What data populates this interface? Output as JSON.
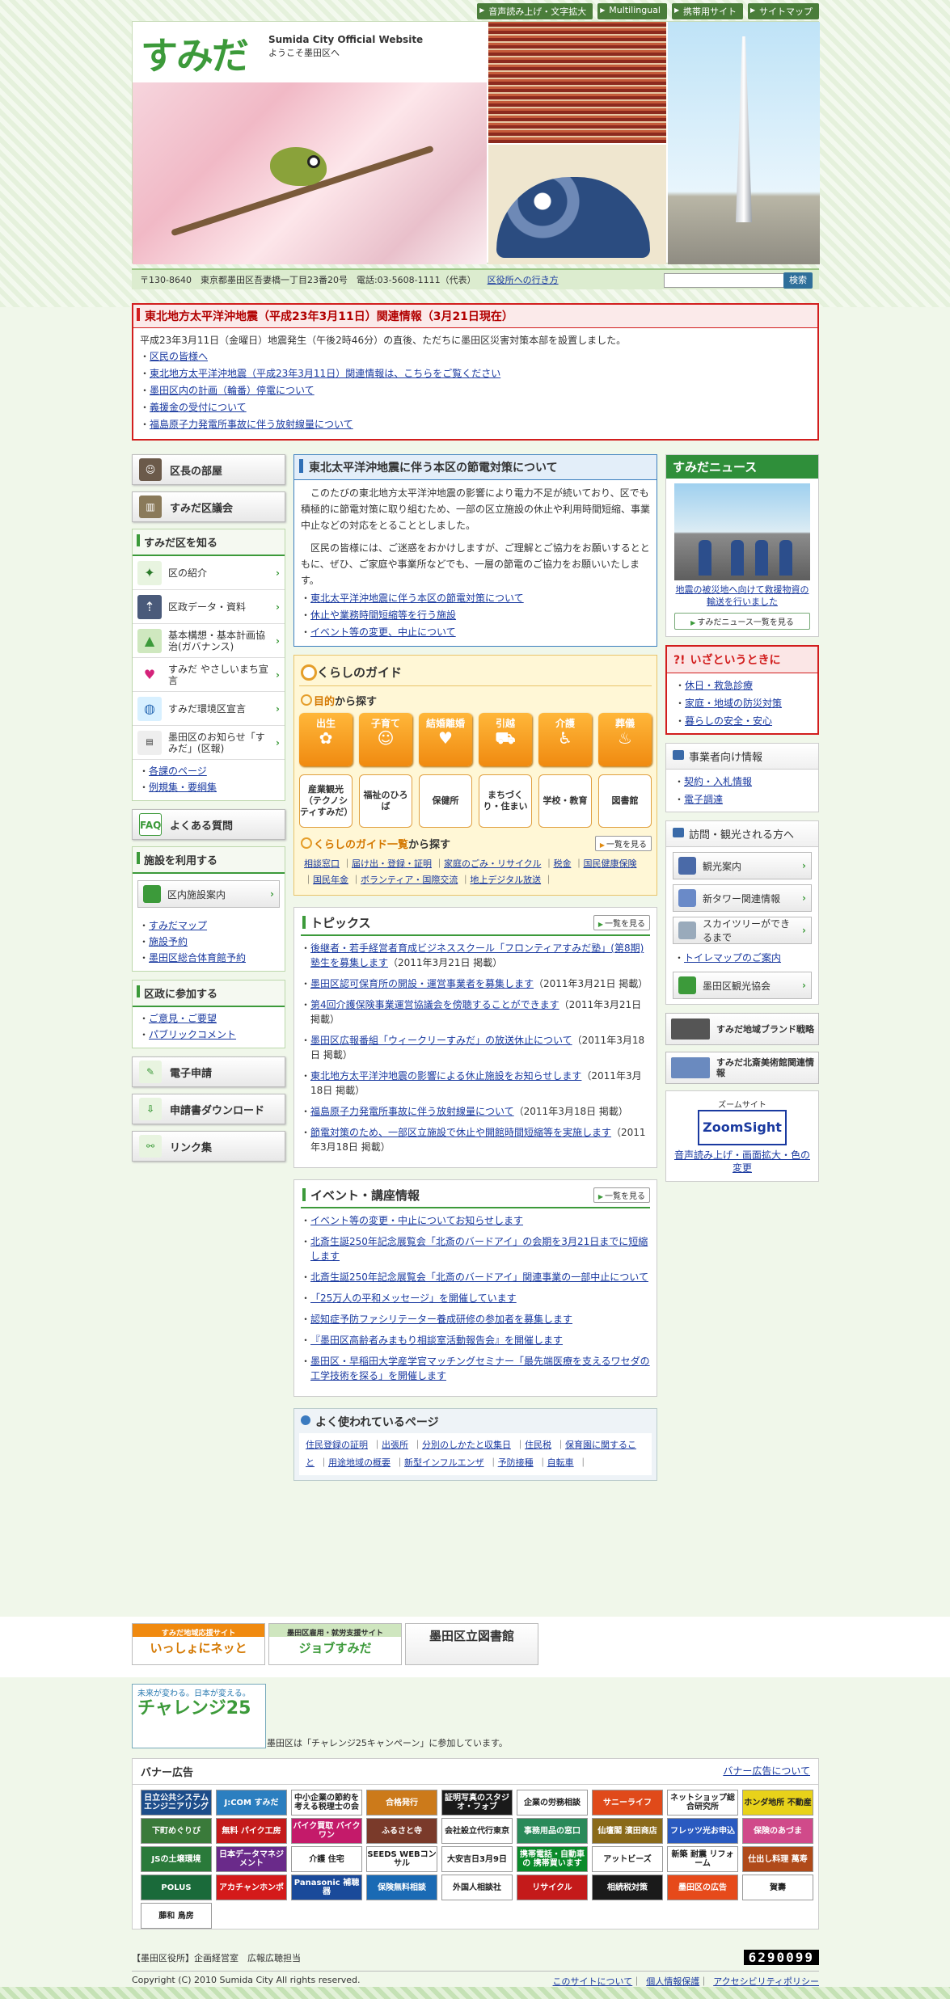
{
  "util": [
    "音声読み上げ・文字拡大",
    "Multilingual",
    "携帯用サイト",
    "サイトマップ"
  ],
  "logo": {
    "text": "すみだ",
    "sub1": "Sumida City  Official Website",
    "sub2": "ようこそ墨田区へ"
  },
  "addr": {
    "text": "〒130-8640　東京都墨田区吾妻橋一丁目23番20号　電話:03-5608-1111（代表）",
    "link": "区役所への行き方",
    "search_btn": "検索"
  },
  "emergency": {
    "title": "東北地方太平洋沖地震（平成23年3月11日）関連情報（3月21日現在）",
    "body": "平成23年3月11日（金曜日）地震発生（午後2時46分）の直後、ただちに墨田区災害対策本部を設置しました。",
    "links": [
      "区民の皆様へ",
      "東北地方太平洋沖地震（平成23年3月11日）関連情報は、こちらをご覧ください",
      "墨田区内の計画（輪番）停電について",
      "義援金の受付について",
      "福島原子力発電所事故に伴う放射線量について"
    ]
  },
  "left": {
    "btn_mayor": "区長の部屋",
    "btn_council": "すみだ区議会",
    "know_title": "すみだ区を知る",
    "know_items": [
      "区の紹介",
      "区政データ・資料",
      "基本構想・基本計画協治(ガバナンス)",
      "すみだ やさしいまち宣言",
      "すみだ環境区宣言",
      "墨田区のお知らせ「すみだ」(区報)"
    ],
    "know_links": [
      "各課のページ",
      "例規集・要綱集"
    ],
    "faq": "よくある質問",
    "facility_title": "施設を利用する",
    "facility_btn": "区内施設案内",
    "facility_links": [
      "すみだマップ",
      "施設予約",
      "墨田区総合体育館予約"
    ],
    "join_title": "区政に参加する",
    "join_links": [
      "ご意見・ご要望",
      "パブリックコメント"
    ],
    "btn_e": "電子申請",
    "btn_dl": "申請書ダウンロード",
    "btn_link": "リンク集"
  },
  "save": {
    "title": "東北太平洋沖地震に伴う本区の節電対策について",
    "p1": "このたびの東北地方太平洋沖地震の影響により電力不足が続いており、区でも積極的に節電対策に取り組むため、一部の区立施設の休止や利用時間短縮、事業中止などの対応をとることとしました。",
    "p2": "区民の皆様には、ご迷惑をおかけしますが、ご理解とご協力をお願いするとともに、ぜひ、ご家庭や事業所などでも、一層の節電のご協力をお願いいたします。",
    "links": [
      "東北太平洋沖地震に伴う本区の節電対策について",
      "休止や業務時間短縮等を行う施設",
      "イベント等の変更、中止について"
    ]
  },
  "guide": {
    "title": "くらしのガイド",
    "purpose_em": "目的",
    "purpose": "から探す",
    "tiles1": [
      "出生",
      "子育て",
      "結婚離婚",
      "引越",
      "介護",
      "葬儀"
    ],
    "icons1": [
      "✿",
      "☺",
      "♥",
      "⛟",
      "♿",
      "♨"
    ],
    "tiles2": [
      "産業観光（テクノシティすみだ）",
      "福祉のひろば",
      "保健所",
      "まちづくり・住まい",
      "学校・教育",
      "図書館"
    ],
    "list_em": "くらしのガイド一覧",
    "list": "から探す",
    "more": "一覧を見る",
    "links": [
      "相談窓口",
      "届け出・登録・証明",
      "家庭のごみ・リサイクル",
      "税金",
      "国民健康保険",
      "国民年金",
      "ボランティア・国際交流",
      "地上デジタル放送"
    ]
  },
  "topics": {
    "title": "トピックス",
    "more": "一覧を見る",
    "items": [
      {
        "t": "後継者・若手経営者育成ビジネススクール「フロンティアすみだ塾」(第8期)塾生を募集します",
        "d": "（2011年3月21日 掲載）"
      },
      {
        "t": "墨田区認可保育所の開設・運営事業者を募集します",
        "d": "（2011年3月21日 掲載）"
      },
      {
        "t": "第4回介護保険事業運営協議会を傍聴することができます",
        "d": "（2011年3月21日 掲載）"
      },
      {
        "t": "墨田区広報番組「ウィークリーすみだ」の放送休止について",
        "d": "（2011年3月18日 掲載）"
      },
      {
        "t": "東北地方太平洋沖地震の影響による休止施設をお知らせします",
        "d": "（2011年3月18日 掲載）"
      },
      {
        "t": "福島原子力発電所事故に伴う放射線量について",
        "d": "（2011年3月18日 掲載）"
      },
      {
        "t": "節電対策のため、一部区立施設で休止や開館時間短縮等を実施します",
        "d": "（2011年3月18日 掲載）"
      }
    ]
  },
  "events": {
    "title": "イベント・講座情報",
    "more": "一覧を見る",
    "items": [
      "イベント等の変更・中止についてお知らせします",
      "北斎生誕250年記念展覧会「北斎のバードアイ」の会期を3月21日までに短縮します",
      "北斎生誕250年記念展覧会「北斎のバードアイ」関連事業の一部中止について",
      "「25万人の平和メッセージ」を開催しています",
      "認知症予防ファシリテーター養成研修の参加者を募集します",
      "『墨田区高齢者みまもり相談室活動報告会』を開催します",
      "墨田区・早稲田大学産学官マッチングセミナー「最先端医療を支えるワセダの工学技術を探る」を開催します"
    ]
  },
  "often": {
    "title": "よく使われているページ",
    "links": [
      "住民登録の証明",
      "出張所",
      "分別のしかたと収集日",
      "住民税",
      "保育園に関すること",
      "用途地域の概要",
      "新型インフルエンザ",
      "予防接種",
      "自転車"
    ]
  },
  "right": {
    "news_title": "すみだニュース",
    "news_cap": "地震の被災地へ向けて救援物資の輸送を行いました",
    "news_more": "すみだニュース一覧を見る",
    "emerg_mark": "?!",
    "emerg_title": "いざというときに",
    "emerg_links": [
      "休日・救急診療",
      "家庭・地域の防災対策",
      "暮らしの安全・安心"
    ],
    "biz_title": "事業者向け情報",
    "biz_links": [
      "契約・入札情報",
      "電子調達"
    ],
    "visit_title": "訪問・観光される方へ",
    "visit_btns": [
      "観光案内",
      "新タワー関連情報",
      "スカイツリーができるまで"
    ],
    "visit_link": "トイレマップのご案内",
    "visit_btn4": "墨田区観光協会",
    "banner1": "すみだ地域ブランド戦略",
    "banner2": "すみだ北斎美術館関連情報",
    "zoom_top": "ズームサイト",
    "zoom_logo": "ZoomSight",
    "zoom_link": "音声読み上げ・画面拡大・色の変更"
  },
  "footbanners": [
    {
      "s": "すみだ地域応援サイト",
      "b": "いっしょにネッと"
    },
    {
      "s": "墨田区雇用・就労支援サイト",
      "b": "ジョブすみだ"
    },
    {
      "s": "",
      "b": "墨田区立図書館"
    }
  ],
  "challenge": {
    "logo": "チャレンジ25",
    "tag": "未来が変わる。日本が変える。",
    "text": "墨田区は「チャレンジ25キャンペーン」に参加しています。"
  },
  "banner_ad": {
    "title": "バナー広告",
    "link": "バナー広告について",
    "ads": [
      "日立公共システムエンジニアリング",
      "J:COM すみだ",
      "中小企業の節約を考える税理士の会",
      "合格発行",
      "証明写真のスタジオ・フォブ",
      "企業の労務相談",
      "サニーライフ",
      "ネットショップ総合研究所",
      "ホンダ地所 不動産",
      "下町めぐりび",
      "無料 パイク工房",
      "バイク買取 バイクワン",
      "ふるさと寺",
      "会社設立代行東京",
      "事務用品の窓口",
      "仙壇閣 濱田商店",
      "フレッツ光お申込",
      "保険のあづま",
      "JSの土壌環境",
      "日本データマネジメント",
      "介護 住宅",
      "SEEDS WEBコンサル",
      "大安吉日3月9日",
      "携帯電話・自動車の 携帯買います",
      "アットビーズ",
      "新築 耐震 リフォーム",
      "仕出し料理 萬寿",
      "POLUS",
      "アカチャンホンポ",
      "Panasonic 補聴器",
      "保険無料相談",
      "外国人相談社",
      "リサイクル",
      "相続税対策",
      "墨田区の広告",
      "賀壽",
      "藤和 鳥房"
    ],
    "colors": [
      "#1d4d8a",
      "#2c7fc0",
      "#fff",
      "#cc7a1a",
      "#1a1a1a",
      "#fff",
      "#e04a1a",
      "#fff",
      "#e8d21a",
      "#3a7a3a",
      "#c41a1a",
      "#c41a6a",
      "#7a3a2a",
      "#fff",
      "#2a8a5a",
      "#8a6a1a",
      "#2a5ac0",
      "#d04a8a",
      "#2a7a3a",
      "#6a2a8a",
      "#fff",
      "#fff",
      "#fff",
      "#0a8a2a",
      "#fff",
      "#fff",
      "#b04a1a",
      "#1a6a3a",
      "#d41a1a",
      "#1a4a9a",
      "#1a6ab4",
      "#fff",
      "#c41a1a",
      "#1a1a1a",
      "#e64a1a",
      "#fff",
      "#fff"
    ]
  },
  "footer": {
    "org": "【墨田区役所】企画経営室　広報広聴担当",
    "counter": "6290099",
    "copy": "Copyright (C) 2010 Sumida City All rights reserved.",
    "links": [
      "このサイトについて",
      "個人情報保護",
      "アクセシビリティポリシー"
    ]
  }
}
